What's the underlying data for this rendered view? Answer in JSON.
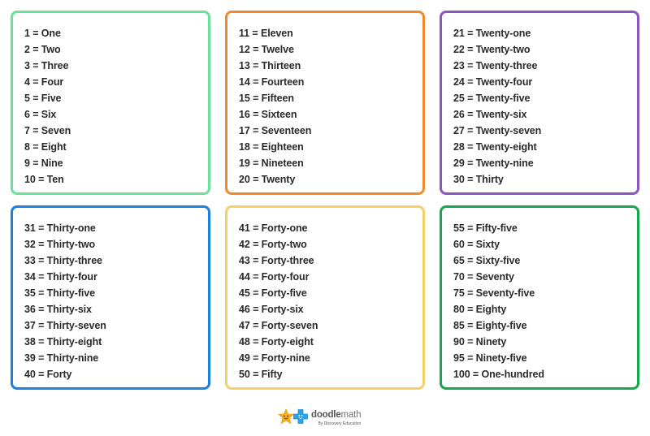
{
  "cards": [
    {
      "color": "#6be09a",
      "items": [
        "1 = One",
        "2 = Two",
        "3 = Three",
        "4 = Four",
        "5 = Five",
        "6 = Six",
        "7 = Seven",
        "8 = Eight",
        "9 = Nine",
        "10 = Ten"
      ]
    },
    {
      "color": "#ee8a2e",
      "items": [
        "11 = Eleven",
        "12 = Twelve",
        "13 = Thirteen",
        "14 = Fourteen",
        "15 = Fifteen",
        "16 = Sixteen",
        "17 = Seventeen",
        "18 = Eighteen",
        "19 = Nineteen",
        "20 = Twenty"
      ]
    },
    {
      "color": "#8b57bf",
      "items": [
        "21 = Twenty-one",
        "22 = Twenty-two",
        "23 = Twenty-three",
        "24 = Twenty-four",
        "25 = Twenty-five",
        "26 = Twenty-six",
        "27 = Twenty-seven",
        "28 = Twenty-eight",
        "29 = Twenty-nine",
        "30 = Thirty"
      ]
    },
    {
      "color": "#1b7fe0",
      "items": [
        "31 = Thirty-one",
        "32 = Thirty-two",
        "33 = Thirty-three",
        "34 = Thirty-four",
        "35 = Thirty-five",
        "36 = Thirty-six",
        "37 = Thirty-seven",
        "38 = Thirty-eight",
        "39 = Thirty-nine",
        "40 = Forty"
      ]
    },
    {
      "color": "#f5d06a",
      "items": [
        "41 = Forty-one",
        "42 = Forty-two",
        "43 = Forty-three",
        "44 = Forty-four",
        "45 = Forty-five",
        "46 = Forty-six",
        "47 = Forty-seven",
        "48 = Forty-eight",
        "49 = Forty-nine",
        "50 = Fifty"
      ]
    },
    {
      "color": "#15a84a",
      "items": [
        "55 = Fifty-five",
        "60 = Sixty",
        "65 = Sixty-five",
        "70 = Seventy",
        "75 = Seventy-five",
        "80 = Eighty",
        "85 = Eighty-five",
        "90 = Ninety",
        "95 = Ninety-five",
        "100 = One-hundred"
      ]
    }
  ],
  "logo": {
    "brand_bold": "doodle",
    "brand_light": "math",
    "tagline": "By Discovery Education",
    "icons": [
      "star-mascot-icon",
      "plus-mascot-icon"
    ]
  }
}
